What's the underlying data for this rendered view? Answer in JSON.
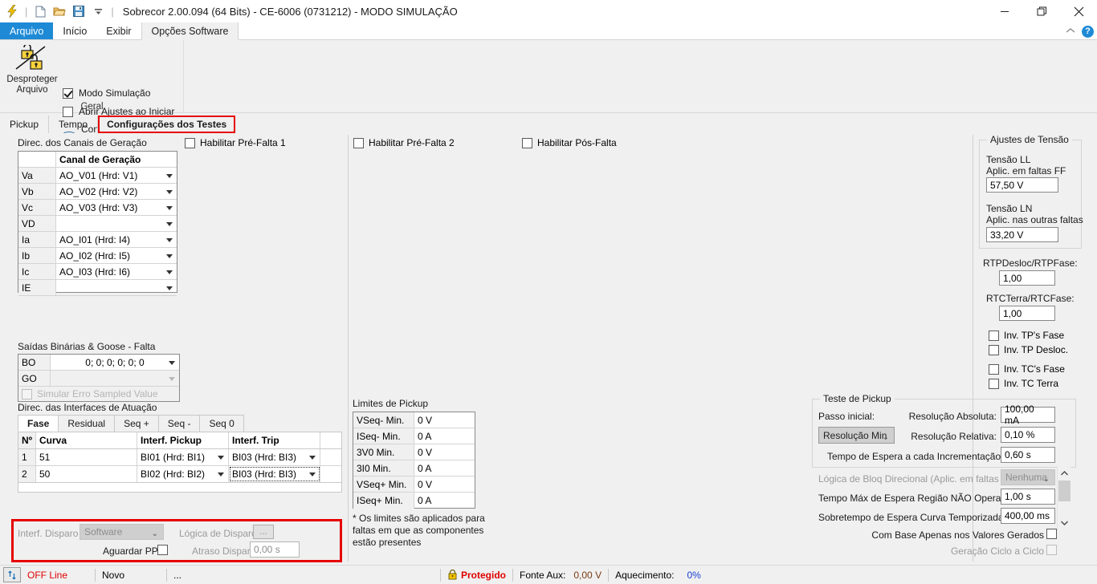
{
  "window": {
    "title": "Sobrecor 2.00.094 (64 Bits) - CE-6006 (0731212) - MODO SIMULAÇÃO",
    "quick_access": [
      "lightning-icon",
      "new-file-icon",
      "open-folder-icon",
      "save-icon",
      "dropdown-icon"
    ],
    "controls": {
      "minimize": "—",
      "maximize": "❐",
      "close": "✕"
    }
  },
  "ribbon": {
    "tabs": [
      {
        "label": "Arquivo",
        "state": "blue"
      },
      {
        "label": "Início",
        "state": "normal"
      },
      {
        "label": "Exibir",
        "state": "normal"
      },
      {
        "label": "Opções Software",
        "state": "selected"
      }
    ],
    "collapse_icon": "chevron-up-icon",
    "help_icon": "?",
    "group": {
      "name": "Geral",
      "big_button": "Desproteger\nArquivo",
      "big_button_line1": "Desproteger",
      "big_button_line2": "Arquivo",
      "options": [
        {
          "label": "Modo Simulação",
          "checked": true,
          "type": "checkbox"
        },
        {
          "label": "Abrir Ajustes ao Iniciar",
          "checked": false,
          "type": "checkbox"
        },
        {
          "label": "Contato com Fabricante",
          "checked": false,
          "type": "link"
        }
      ]
    }
  },
  "doc_tabs": [
    {
      "label": "Pickup",
      "selected": false
    },
    {
      "label": "Tempo",
      "selected": false
    },
    {
      "label": "Configurações dos Testes",
      "selected": true
    }
  ],
  "generation": {
    "section_label": "Direc. dos Canais de Geração",
    "header": [
      "",
      "Canal de Geração"
    ],
    "rows": [
      {
        "name": "Va",
        "value": "AO_V01 (Hrd: V1)"
      },
      {
        "name": "Vb",
        "value": "AO_V02 (Hrd: V2)"
      },
      {
        "name": "Vc",
        "value": "AO_V03 (Hrd: V3)"
      },
      {
        "name": "VD",
        "value": ""
      },
      {
        "name": "Ia",
        "value": "AO_I01 (Hrd: I4)"
      },
      {
        "name": "Ib",
        "value": "AO_I02 (Hrd: I5)"
      },
      {
        "name": "Ic",
        "value": "AO_I03 (Hrd: I6)"
      },
      {
        "name": "IE",
        "value": ""
      }
    ]
  },
  "fault_checks": [
    {
      "label": "Habilitar Pré-Falta 1",
      "checked": false
    },
    {
      "label": "Habilitar Pré-Falta 2",
      "checked": false
    },
    {
      "label": "Habilitar Pós-Falta",
      "checked": false
    }
  ],
  "binary_outputs": {
    "section_label": "Saídas Binárias & Goose - Falta",
    "rows": [
      {
        "name": "BO",
        "value": "0; 0; 0; 0; 0; 0",
        "enabled": true
      },
      {
        "name": "GO",
        "value": "",
        "enabled": false
      }
    ],
    "sampled_value": {
      "label": "Simular Erro Sampled Value",
      "checked": false,
      "enabled": false
    }
  },
  "actuation": {
    "section_label": "Direc. das Interfaces de Atuação",
    "tabs": [
      {
        "label": "Fase",
        "selected": true
      },
      {
        "label": "Residual",
        "selected": false
      },
      {
        "label": "Seq +",
        "selected": false
      },
      {
        "label": "Seq -",
        "selected": false
      },
      {
        "label": "Seq 0",
        "selected": false
      }
    ],
    "columns": [
      "Nº",
      "Curva",
      "Interf. Pickup",
      "Interf. Trip"
    ],
    "rows": [
      {
        "n": "1",
        "curva": "51",
        "pickup": "BI01 (Hrd: BI1)",
        "trip": "BI03 (Hrd: BI3)",
        "focused": false
      },
      {
        "n": "2",
        "curva": "50",
        "pickup": "BI02 (Hrd: BI2)",
        "trip": "BI03 (Hrd: BI3)",
        "focused": true
      }
    ]
  },
  "trigger": {
    "interface_label": "Interf. Disparo",
    "interface_value": "Software",
    "logic_label": "Lógica de Disparo",
    "logic_button": "...",
    "wait_pps_label": "Aguardar PPS",
    "wait_pps_checked": false,
    "delay_label": "Atraso Disparo",
    "delay_value": "0,00 s"
  },
  "pickup_limits": {
    "section_label": "Limites de Pickup",
    "rows": [
      {
        "name": "VSeq- Min.",
        "value": "0 V"
      },
      {
        "name": "ISeq- Min.",
        "value": "0 A"
      },
      {
        "name": "3V0 Min.",
        "value": "0 V"
      },
      {
        "name": "3I0 Min.",
        "value": "0 A"
      },
      {
        "name": "VSeq+ Min.",
        "value": "0 V"
      },
      {
        "name": "ISeq+ Min.",
        "value": "0 A"
      }
    ],
    "note_line1": "* Os limites são aplicados para",
    "note_line2": "faltas em que as componentes",
    "note_line3": "estão presentes"
  },
  "voltage_settings": {
    "group_title": "Ajustes de Tensão",
    "ll_label_line1": "Tensão LL",
    "ll_label_line2": "Aplic. em faltas FF",
    "ll_value": "57,50 V",
    "ln_label_line1": "Tensão LN",
    "ln_label_line2": "Aplic. nas outras faltas",
    "ln_value": "33,20 V",
    "rtp_label": "RTPDesloc/RTPFase:",
    "rtp_value": "1,00",
    "rtc_label": "RTCTerra/RTCFase:",
    "rtc_value": "1,00",
    "inversions": [
      {
        "label": "Inv. TP's Fase",
        "checked": false
      },
      {
        "label": "Inv. TP Desloc.",
        "checked": false
      },
      {
        "label": "Inv. TC's Fase",
        "checked": false
      },
      {
        "label": "Inv. TC Terra",
        "checked": false
      }
    ]
  },
  "pickup_test": {
    "group_title": "Teste de Pickup",
    "step_label": "Passo inicial:",
    "step_value": "Resolução Min",
    "abs_label": "Resolução Absoluta:",
    "abs_value": "100,00 mA",
    "rel_label": "Resolução Relativa:",
    "rel_value": "0,10 %",
    "wait_label": "Tempo de Espera a cada Incrementação:",
    "wait_value": "0,60 s"
  },
  "advanced": {
    "block_logic_label": "Lógica de Bloq Direcional (Aplic. em faltas FF):",
    "block_logic_value": "Nenhuma",
    "max_wait_label": "Tempo Máx de Espera Região NÃO Operação:",
    "max_wait_value": "1,00 s",
    "overtime_label": "Sobretempo de Espera Curva Temporizada:",
    "overtime_value": "400,00 ms",
    "only_generated_label": "Com Base Apenas nos Valores Gerados",
    "only_generated_checked": false,
    "cycle_label": "Geração Ciclo a Ciclo",
    "cycle_checked": false,
    "scroll_up": "⌃",
    "scroll_down": "⌄"
  },
  "status_bar": {
    "connection_icon": "connect-icon",
    "state": "OFF Line",
    "file": "Novo",
    "path": "...",
    "protected_icon": "lock-icon",
    "protected": "Protegido",
    "aux_label": "Fonte Aux:",
    "aux_value": "0,00 V",
    "heating_label": "Aquecimento:",
    "heating_value": "0%"
  },
  "colors": {
    "accent_blue": "#1e8ad6",
    "highlight_red": "#e60000",
    "status_red": "#e00000",
    "status_blue": "#1a3fd0",
    "panel_bg": "#f0f0f0"
  }
}
